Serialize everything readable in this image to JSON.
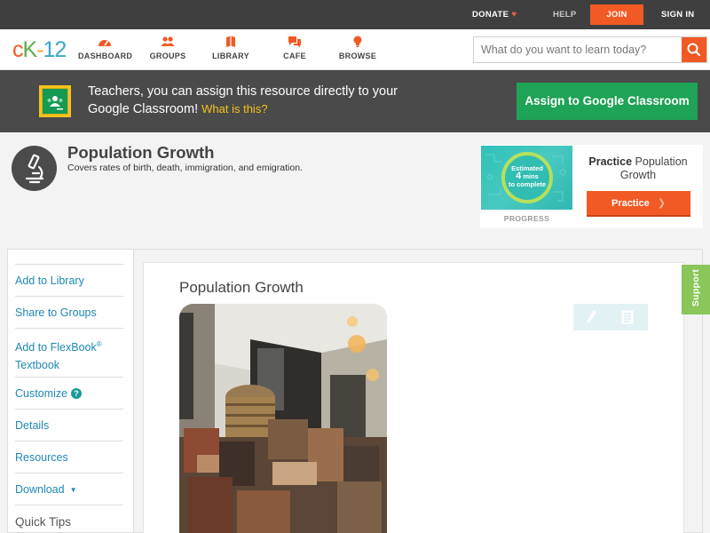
{
  "topbar": {
    "donate": "DONATE",
    "help": "HELP",
    "join": "JOIN",
    "signin": "SIGN IN"
  },
  "nav": {
    "logo_c": "c",
    "logo_k": "K",
    "logo_dash": "-",
    "logo_12": "12",
    "items": [
      {
        "label": "DASHBOARD",
        "icon": "dashboard-icon"
      },
      {
        "label": "GROUPS",
        "icon": "groups-icon"
      },
      {
        "label": "LIBRARY",
        "icon": "library-icon"
      },
      {
        "label": "CAFE",
        "icon": "cafe-icon"
      },
      {
        "label": "BROWSE",
        "icon": "browse-icon"
      }
    ],
    "search_placeholder": "What do you want to learn today?"
  },
  "banner": {
    "text": "Teachers, you can assign this resource directly to your Google Classroom!",
    "what_is_this": "What is this?",
    "assign_label": "Assign to Google Classroom"
  },
  "concept": {
    "title": "Population Growth",
    "description": "Covers rates of birth, death, immigration, and emigration."
  },
  "practice": {
    "ring_line1": "Estimated",
    "ring_num": "4",
    "ring_line2": "mins",
    "ring_line3": "to complete",
    "progress_label": "PROGRESS",
    "title_bold": "Practice",
    "title_rest": "Population Growth",
    "button_label": "Practice"
  },
  "sidebar": {
    "add_library": "Add to Library",
    "share_groups": "Share to Groups",
    "add_flexbook_1": "Add to FlexBook",
    "add_flexbook_sup": "®",
    "add_flexbook_2": "Textbook",
    "customize": "Customize",
    "details": "Details",
    "resources": "Resources",
    "download": "Download",
    "quick_tips": "Quick Tips"
  },
  "content": {
    "title": "Population Growth"
  },
  "support_label": "Support",
  "colors": {
    "brand_orange": "#f15a25",
    "google_green": "#1fa356",
    "link_blue": "#1f88b5",
    "support_green": "#8ac65a"
  }
}
